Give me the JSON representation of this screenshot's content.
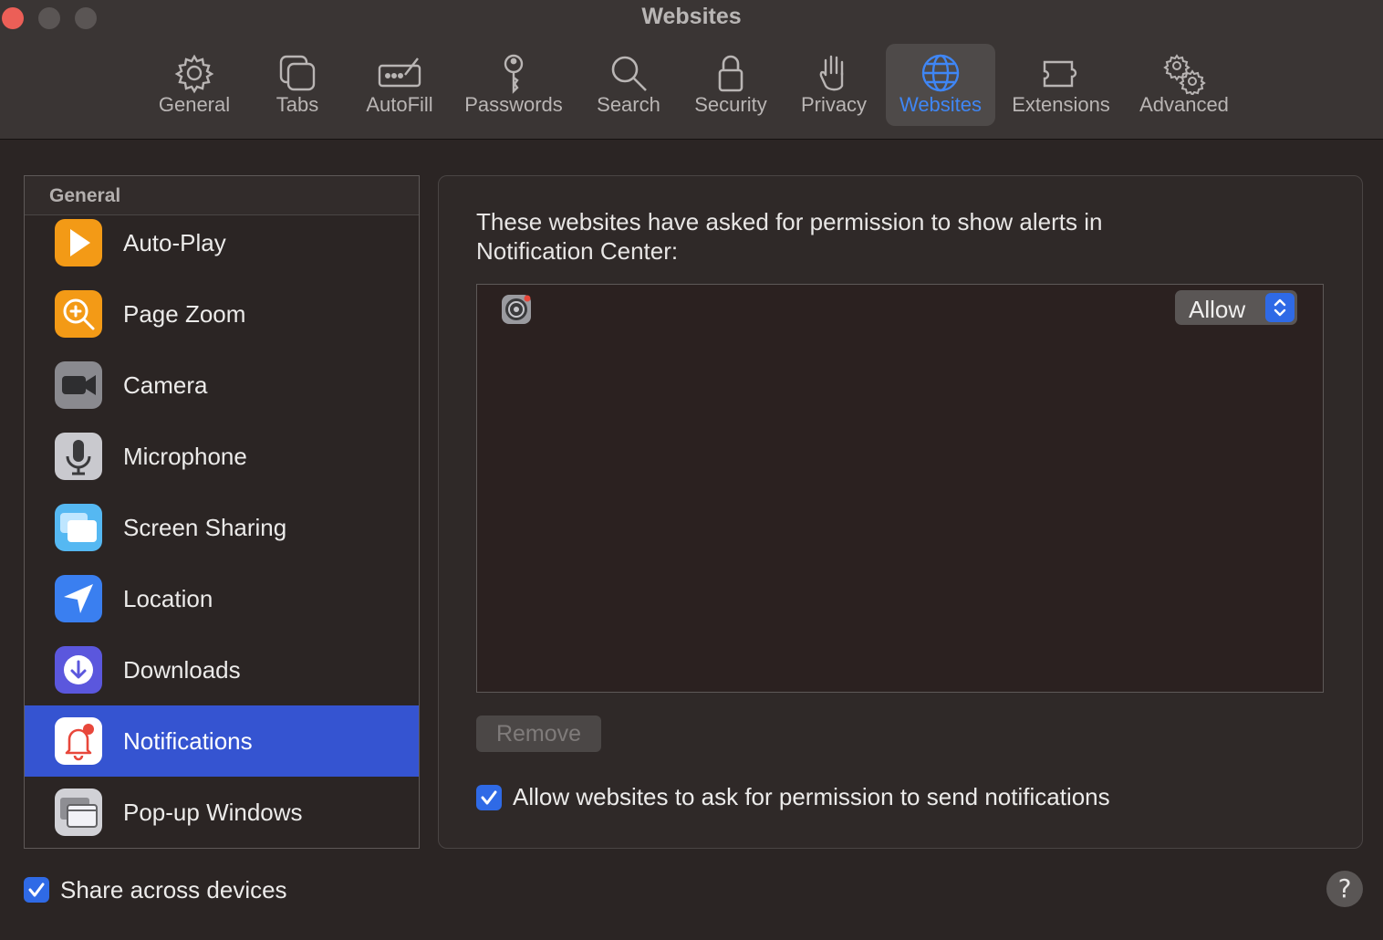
{
  "window": {
    "title": "Websites"
  },
  "toolbar": {
    "tabs": [
      {
        "label": "General",
        "icon": "gear-icon"
      },
      {
        "label": "Tabs",
        "icon": "tabs-icon"
      },
      {
        "label": "AutoFill",
        "icon": "autofill-icon"
      },
      {
        "label": "Passwords",
        "icon": "key-icon"
      },
      {
        "label": "Search",
        "icon": "search-icon"
      },
      {
        "label": "Security",
        "icon": "lock-icon"
      },
      {
        "label": "Privacy",
        "icon": "hand-icon"
      },
      {
        "label": "Websites",
        "icon": "globe-icon",
        "active": true
      },
      {
        "label": "Extensions",
        "icon": "puzzle-icon"
      },
      {
        "label": "Advanced",
        "icon": "gears-icon"
      }
    ]
  },
  "sidebar": {
    "header": "General",
    "items": [
      {
        "label": "Auto-Play",
        "icon": "play-icon",
        "color": "#f59b14"
      },
      {
        "label": "Page Zoom",
        "icon": "zoom-icon",
        "color": "#f59b14"
      },
      {
        "label": "Camera",
        "icon": "camera-icon",
        "color": "#8e8e93"
      },
      {
        "label": "Microphone",
        "icon": "microphone-icon",
        "color": "#c7c7cc"
      },
      {
        "label": "Screen Sharing",
        "icon": "screen-sharing-icon",
        "color": "#5ac8fa"
      },
      {
        "label": "Location",
        "icon": "location-arrow-icon",
        "color": "#3b82f6"
      },
      {
        "label": "Downloads",
        "icon": "download-icon",
        "color": "#5e5ce6"
      },
      {
        "label": "Notifications",
        "icon": "bell-icon",
        "color": "#ffffff",
        "selected": true
      },
      {
        "label": "Pop-up Windows",
        "icon": "popup-windows-icon",
        "color": "#d1d1d6"
      }
    ]
  },
  "main": {
    "description": "These websites have asked for permission to show alerts in Notification Center:",
    "sites": [
      {
        "icon": "system-preferences-icon",
        "permission": "Allow"
      }
    ],
    "remove_label": "Remove",
    "allow_ask_label": "Allow websites to ask for permission to send notifications",
    "allow_ask_checked": true
  },
  "footer": {
    "share_label": "Share across devices",
    "share_checked": true,
    "help_label": "?"
  },
  "colors": {
    "accent": "#3f86f5",
    "selection": "#3554d1",
    "checkbox": "#2f6ae6"
  }
}
